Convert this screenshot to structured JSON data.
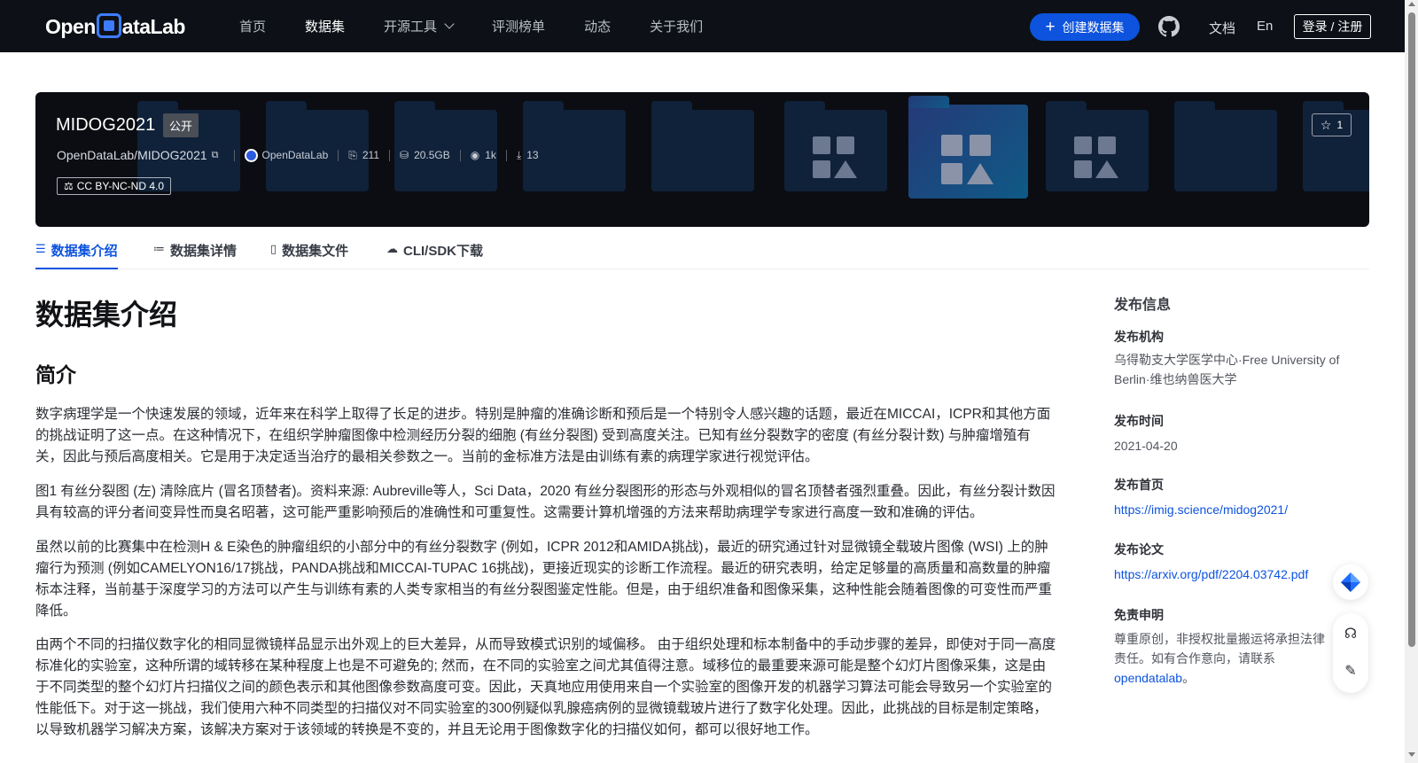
{
  "nav": {
    "logo": {
      "part1": "Open",
      "part2": "ataLab"
    },
    "items": [
      "首页",
      "数据集",
      "开源工具",
      "评测榜单",
      "动态",
      "关于我们"
    ],
    "active": "数据集",
    "create_label": "创建数据集",
    "docs": "文档",
    "lang": "En",
    "login": "登录 / 注册"
  },
  "dataset": {
    "name": "MIDOG2021",
    "visibility": "公开",
    "path": "OpenDataLab/MIDOG2021",
    "publisher": "OpenDataLab",
    "file_count": "211",
    "size": "20.5GB",
    "views": "1k",
    "downloads": "13",
    "license": "CC BY-NC-ND 4.0",
    "stars": "1"
  },
  "tabs": [
    {
      "label": "数据集介绍",
      "icon": "database-icon"
    },
    {
      "label": "数据集详情",
      "icon": "list-icon"
    },
    {
      "label": "数据集文件",
      "icon": "file-icon"
    },
    {
      "label": "CLI/SDK下载",
      "icon": "cloud-icon"
    }
  ],
  "content": {
    "title": "数据集介绍",
    "section": "简介",
    "paragraphs": [
      "数字病理学是一个快速发展的领域，近年来在科学上取得了长足的进步。特别是肿瘤的准确诊断和预后是一个特别令人感兴趣的话题，最近在MICCAI，ICPR和其他方面的挑战证明了这一点。在这种情况下，在组织学肿瘤图像中检测经历分裂的细胞 (有丝分裂图) 受到高度关注。已知有丝分裂数字的密度 (有丝分裂计数) 与肿瘤增殖有关，因此与预后高度相关。它是用于决定适当治疗的最相关参数之一。当前的金标准方法是由训练有素的病理学家进行视觉评估。",
      "图1 有丝分裂图 (左) 清除底片 (冒名顶替者)。资料来源: Aubreville等人，Sci Data，2020 有丝分裂图形的形态与外观相似的冒名顶替者强烈重叠。因此，有丝分裂计数因具有较高的评分者间变异性而臭名昭著，这可能严重影响预后的准确性和可重复性。这需要计算机增强的方法来帮助病理学专家进行高度一致和准确的评估。",
      "虽然以前的比赛集中在检测H & E染色的肿瘤组织的小部分中的有丝分裂数字 (例如，ICPR 2012和AMIDA挑战)，最近的研究通过针对显微镜全载玻片图像 (WSI) 上的肿瘤行为预测 (例如CAMELYON16/17挑战，PANDA挑战和MICCAI-TUPAC 16挑战)，更接近现实的诊断工作流程。最近的研究表明，给定足够量的高质量和高数量的肿瘤标本注释，当前基于深度学习的方法可以产生与训练有素的人类专家相当的有丝分裂图鉴定性能。但是，由于组织准备和图像采集，这种性能会随着图像的可变性而严重降低。",
      "由两个不同的扫描仪数字化的相同显微镜样品显示出外观上的巨大差异，从而导致模式识别的域偏移。 由于组织处理和标本制备中的手动步骤的差异，即使对于同一高度标准化的实验室，这种所谓的域转移在某种程度上也是不可避免的; 然而，在不同的实验室之间尤其值得注意。域移位的最重要来源可能是整个幻灯片图像采集，这是由于不同类型的整个幻灯片扫描仪之间的颜色表示和其他图像参数高度可变。因此，天真地应用使用来自一个实验室的图像开发的机器学习算法可能会导致另一个实验室的性能低下。对于这一挑战，我们使用六种不同类型的扫描仪对不同实验室的300例疑似乳腺癌病例的显微镜载玻片进行了数字化处理。因此，此挑战的目标是制定策略，以导致机器学习解决方案，该解决方案对于该领域的转换是不变的，并且无论用于图像数字化的扫描仪如何，都可以很好地工作。"
    ]
  },
  "sidebar": {
    "title": "发布信息",
    "org_label": "发布机构",
    "org_value": "乌得勒支大学医学中心·Free University of Berlin·维也纳兽医大学",
    "date_label": "发布时间",
    "date_value": "2021-04-20",
    "home_label": "发布首页",
    "home_value": "https://imig.science/midog2021/",
    "paper_label": "发布论文",
    "paper_value": "https://arxiv.org/pdf/2204.03742.pdf",
    "disclaimer_label": "免责申明",
    "disclaimer_text": "尊重原创，非授权批量搬运将承担法律责任。如有合作意向，请联系",
    "disclaimer_link": "opendatalab",
    "disclaimer_end": "。"
  },
  "colors": {
    "brand": "#0d53de",
    "nav_bg": "#0d1117",
    "banner_bg": "#0b0d12"
  }
}
